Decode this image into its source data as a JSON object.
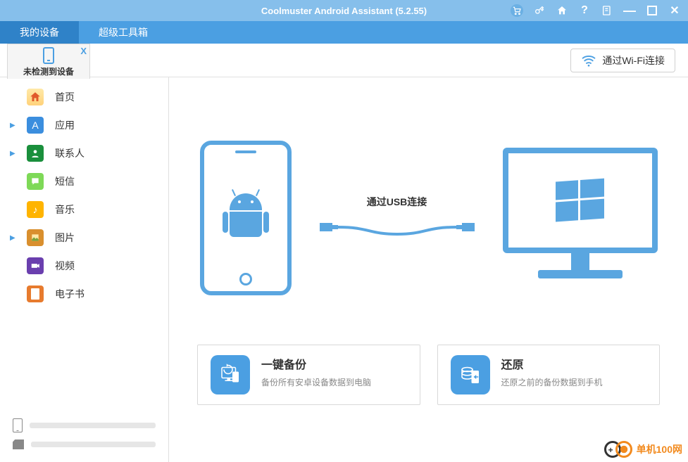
{
  "title": "Coolmuster Android Assistant (5.2.55)",
  "tabs": {
    "my_device": "我的设备",
    "toolbox": "超级工具箱"
  },
  "device_tab": {
    "label": "未检测到设备",
    "close": "X"
  },
  "wifi_button": "通过Wi-Fi连接",
  "nav": {
    "home": "首页",
    "apps": "应用",
    "contacts": "联系人",
    "sms": "短信",
    "music": "音乐",
    "photos": "图片",
    "video": "视频",
    "ebook": "电子书"
  },
  "usb_label": "通过USB连接",
  "cards": {
    "backup": {
      "title": "一键备份",
      "desc": "备份所有安卓设备数据到电脑"
    },
    "restore": {
      "title": "还原",
      "desc": "还原之前的备份数据到手机"
    }
  },
  "watermark": "单机100网"
}
